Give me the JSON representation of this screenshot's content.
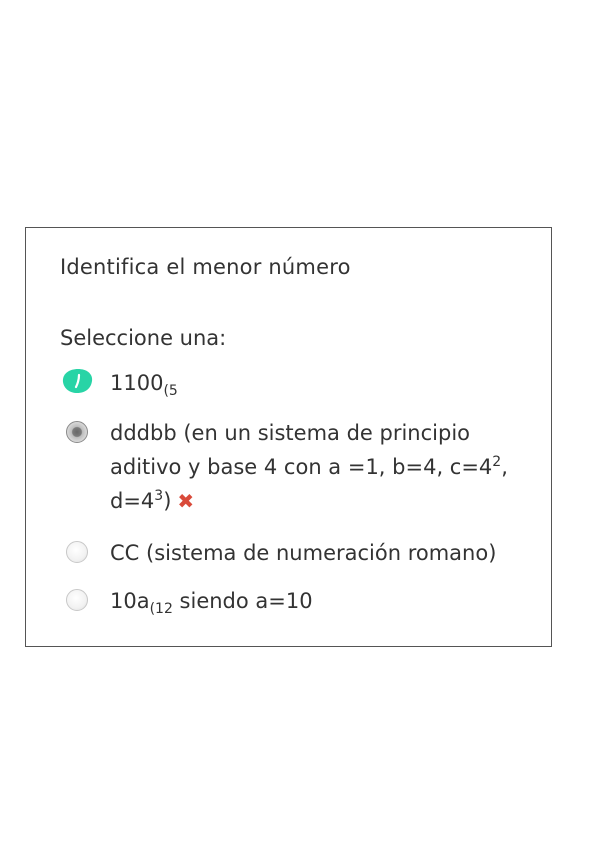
{
  "question": {
    "text": "Identifica el menor número",
    "prompt": "Seleccione una:"
  },
  "options": [
    {
      "main": "1100",
      "sub": "(5",
      "selected": false
    },
    {
      "line1": "dddbb (en un sistema de principio",
      "line2a": "aditivo y base 4 con a =1, b=4, c=4",
      "sup2": "2",
      "line2b": ",",
      "line3a": "d=4",
      "sup3": "3",
      "line3b": ")",
      "selected": true,
      "feedback_icon": "incorrect-x-icon"
    },
    {
      "text": "CC (sistema de numeración romano)",
      "selected": false
    },
    {
      "main": "10a",
      "sub": "(12",
      "rest": " siendo a=10",
      "selected": false
    }
  ],
  "colors": {
    "highlight_mark": "#28d4a6",
    "incorrect": "#d94a3a",
    "border": "#555555"
  }
}
